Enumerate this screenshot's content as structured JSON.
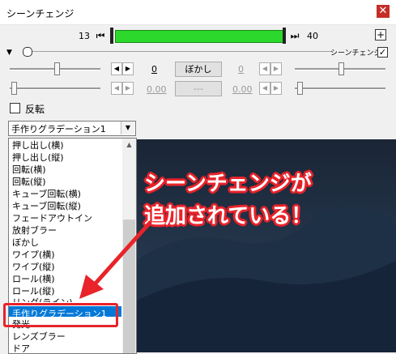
{
  "window": {
    "title": "シーンチェンジ",
    "close_glyph": "✕"
  },
  "timeline": {
    "start_frame": "13",
    "end_frame": "40",
    "prev_glyph": "⏮",
    "next_glyph": "⏭",
    "add_glyph": "+",
    "bar_color": "#2bd82b"
  },
  "header": {
    "collapse_glyph": "▼",
    "mouse_icon": "mouse-icon",
    "label": "シーンチェンジ",
    "checked": "✓"
  },
  "rows": [
    {
      "value_left": "0",
      "button": "ぼかし",
      "value_right": "0",
      "enabled": true
    },
    {
      "value_left": "0.00",
      "button": "---",
      "value_right": "0.00",
      "enabled": false
    }
  ],
  "checkbox": {
    "label": "反転",
    "checked": false
  },
  "combo": {
    "selected": "手作りグラデーション1",
    "arrow": "▼"
  },
  "list": {
    "scroll_up": "▲",
    "items": [
      "押し出し(横)",
      "押し出し(縦)",
      "回転(横)",
      "回転(縦)",
      "キューブ回転(横)",
      "キューブ回転(縦)",
      "フェードアウトイン",
      "放射ブラー",
      "ぼかし",
      "ワイプ(横)",
      "ワイプ(縦)",
      "ロール(横)",
      "ロール(縦)",
      "リング(ライン)",
      "手作りグラデーション1",
      "発光",
      "レンズブラー",
      "ドア"
    ],
    "selected_index": 14,
    "selected_color": "#0078d7"
  },
  "annotation": {
    "line1": "シーンチェンジが",
    "line2": "追加されている！",
    "color": "#e8232a"
  }
}
